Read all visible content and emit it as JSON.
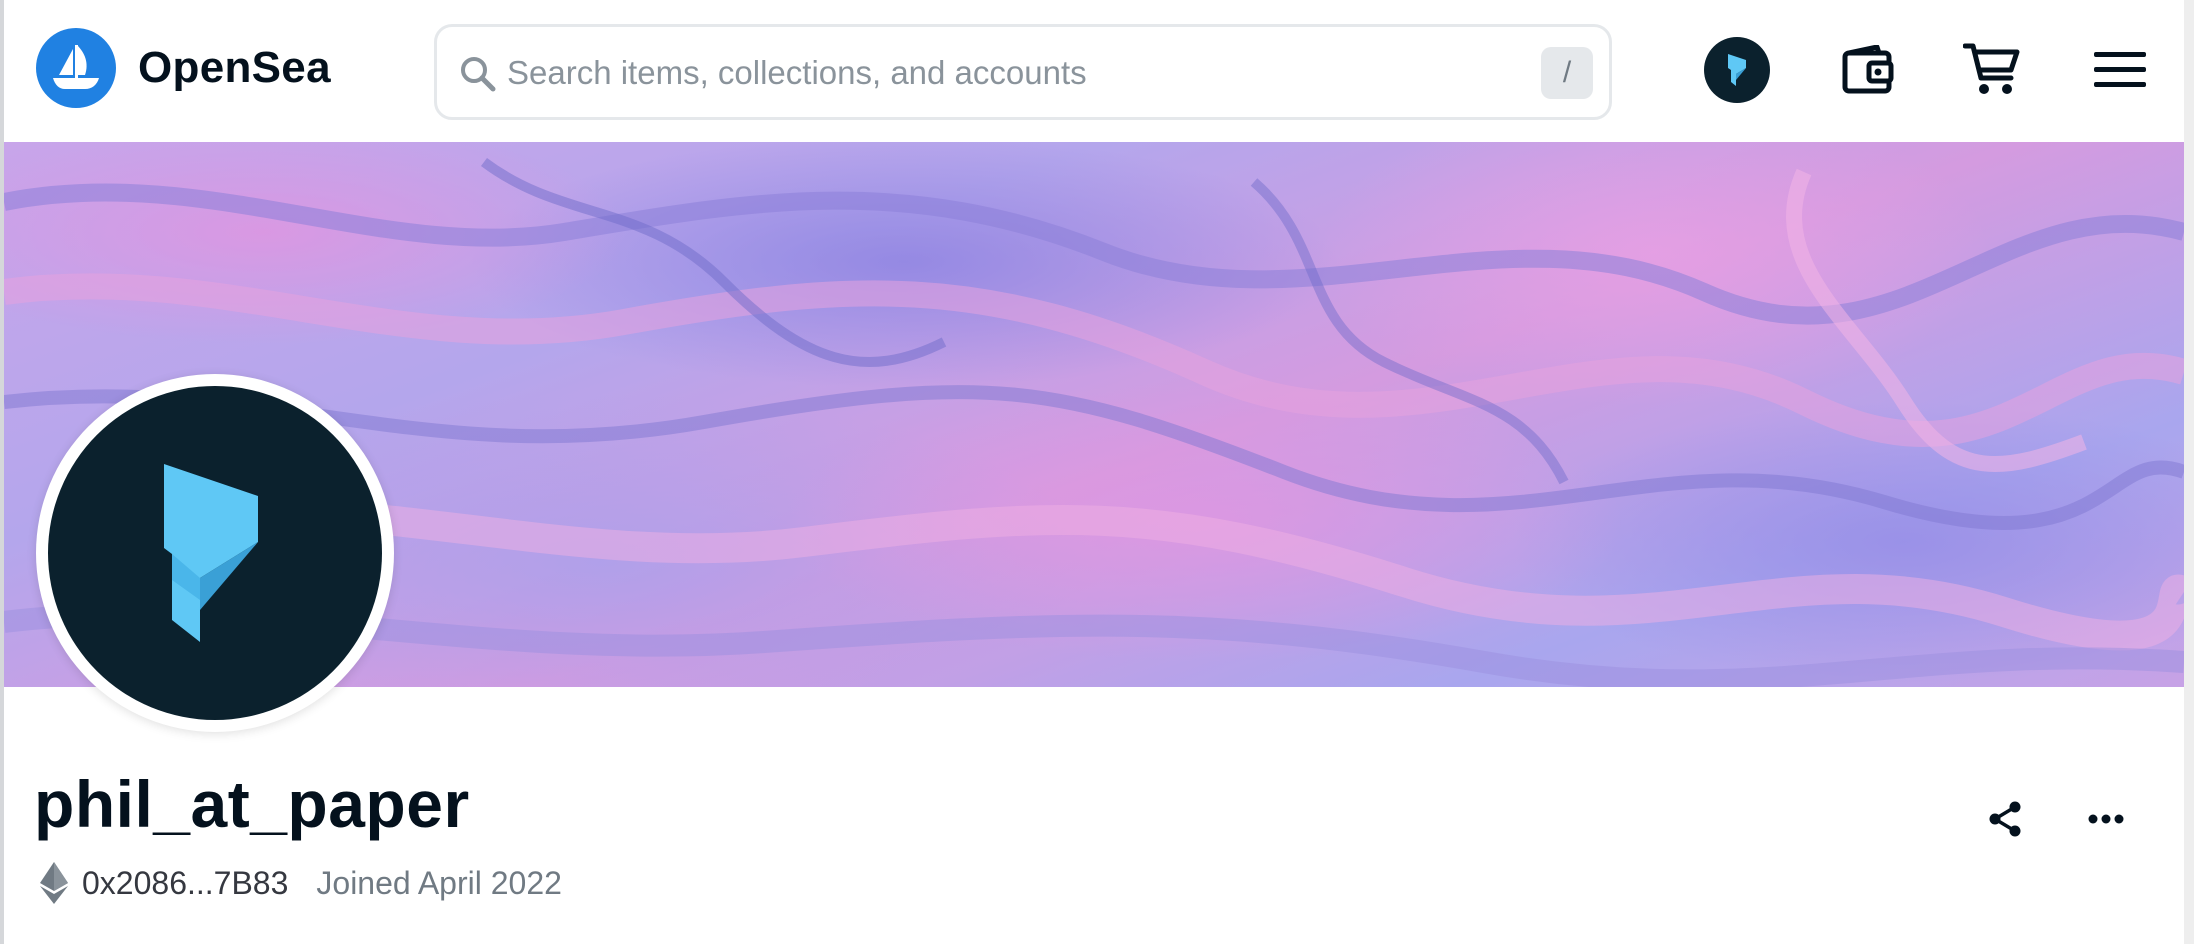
{
  "header": {
    "brand": "OpenSea",
    "search": {
      "placeholder": "Search items, collections, and accounts",
      "shortcut": "/"
    },
    "icons": [
      "account-avatar-icon",
      "wallet-icon",
      "cart-icon",
      "menu-icon"
    ]
  },
  "profile": {
    "username": "phil_at_paper",
    "address": "0x2086...7B83",
    "joined": "Joined April 2022",
    "chain_icon": "ethereum-icon"
  },
  "colors": {
    "brand_blue": "#2081e2",
    "avatar_bg": "#0b212d",
    "logo_accent": "#5fc8f5",
    "text_primary": "#04111d",
    "text_secondary": "#707a83"
  }
}
